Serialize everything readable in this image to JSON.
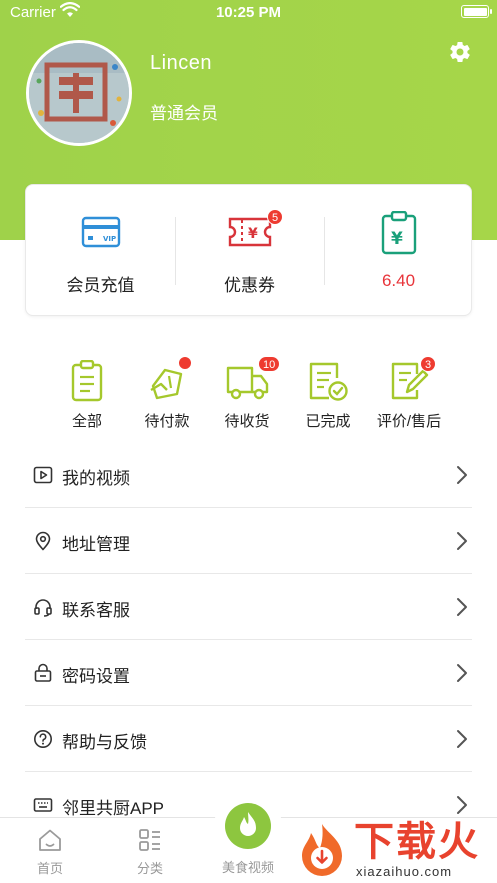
{
  "status_bar": {
    "carrier": "Carrier",
    "time": "10:25 PM"
  },
  "profile": {
    "name": "Lincen",
    "level": "普通会员"
  },
  "wallet": [
    {
      "label": "会员充值",
      "icon": "vip-card-icon"
    },
    {
      "label": "优惠券",
      "icon": "coupon-icon",
      "badge": "5"
    },
    {
      "label": "6.40",
      "icon": "wallet-clipboard-icon"
    }
  ],
  "orders": [
    {
      "label": "全部",
      "icon": "clipboard-icon"
    },
    {
      "label": "待付款",
      "icon": "payment-icon"
    },
    {
      "label": "待收货",
      "icon": "delivery-truck-icon",
      "badge": "10"
    },
    {
      "label": "已完成",
      "icon": "completed-icon"
    },
    {
      "label": "评价/售后",
      "icon": "review-icon",
      "badge": "3"
    }
  ],
  "menu": [
    {
      "label": "我的视频",
      "icon": "video-icon"
    },
    {
      "label": "地址管理",
      "icon": "location-pin-icon"
    },
    {
      "label": "联系客服",
      "icon": "headset-icon"
    },
    {
      "label": "密码设置",
      "icon": "lock-icon"
    },
    {
      "label": "帮助与反馈",
      "icon": "help-icon"
    },
    {
      "label": "邻里共厨APP",
      "icon": "keyboard-icon"
    }
  ],
  "tabbar": [
    {
      "label": "首页",
      "icon": "home-icon"
    },
    {
      "label": "分类",
      "icon": "category-icon"
    },
    {
      "label": "美食视频",
      "icon": "flame-icon"
    }
  ],
  "watermark": {
    "title": "下载火",
    "subtitle": "xiazaihuo.com"
  },
  "colors": {
    "brand_green": "#a2d44a",
    "badge_red": "#ee3b30",
    "icon_blue": "#2f8fd8",
    "icon_red": "#d8343a",
    "icon_teal": "#1aa07a",
    "icon_lime": "#a5c82c"
  }
}
